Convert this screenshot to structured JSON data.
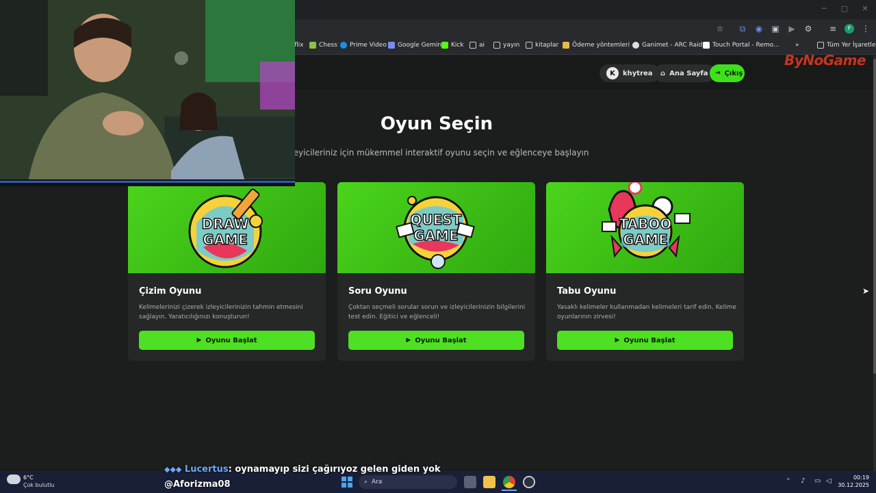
{
  "bookmarks": [
    "flix",
    "Chess",
    "Prime Video",
    "Google Gemini",
    "Kick",
    "ai",
    "yayın",
    "kitaplar",
    "Ödeme yöntemleri -...",
    "Ganimet - ARC Raid...",
    "Touch Portal - Remo...",
    "Tüm Yer İşaretleri"
  ],
  "nav": {
    "user": "khytrea",
    "home": "Ana Sayfa",
    "logout": "Çıkış",
    "logo": "ByNoGame"
  },
  "hero": {
    "title": "Oyun Seçin",
    "subtitle": "İzleyicileriniz için mükemmel interaktif oyunu seçin ve eğlenceye başlayın"
  },
  "cards": [
    {
      "art": "DRAW GAME",
      "title": "Çizim Oyunu",
      "desc": "Kelimelerinizi çizerek izleyicilerinizin tahmin etmesini sağlayın. Yaratıcılığınızı konuşturun!",
      "button": "Oyunu Başlat"
    },
    {
      "art": "QUEST GAME",
      "title": "Soru Oyunu",
      "desc": "Çoktan seçmeli sorular sorun ve izleyicilerinizin bilgilerini test edin. Eğitici ve eğlenceli!",
      "button": "Oyunu Başlat"
    },
    {
      "art": "TABOO GAME",
      "title": "Tabu Oyunu",
      "desc": "Yasaklı kelimeler kullanmadan kelimeleri tarif edin. Kelime oyunlarının zirvesi!",
      "button": "Oyunu Başlat"
    }
  ],
  "chat": {
    "user": "Lucertus",
    "message": ": oynamayıp sizi çağırıyoz gelen giden yok",
    "line2": "@Aforizma08"
  },
  "taskbar": {
    "weather_temp": "6°C",
    "weather_desc": "Çok bulutlu",
    "search": "Ara",
    "time": "00:19",
    "date": "30.12.2025"
  },
  "colors": {
    "accent": "#4ee022",
    "background": "#1c1e1d",
    "card": "#262827"
  }
}
